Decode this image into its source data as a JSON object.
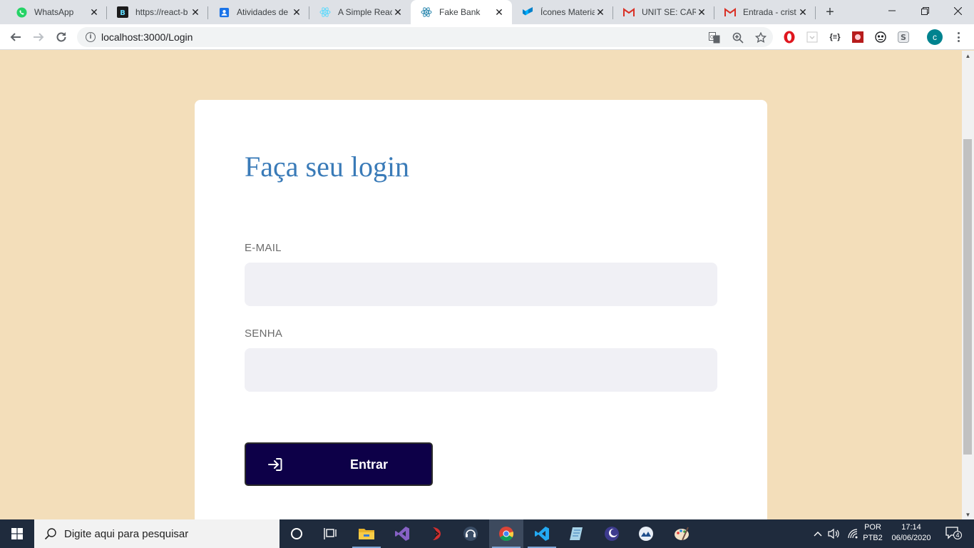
{
  "browser": {
    "tabs": [
      {
        "title": "WhatsApp",
        "icon": "whatsapp-icon"
      },
      {
        "title": "https://react-b",
        "icon": "react-bootstrap-icon"
      },
      {
        "title": "Atividades de ",
        "icon": "contacts-icon"
      },
      {
        "title": "A Simple React",
        "icon": "react-icon"
      },
      {
        "title": "Fake Bank",
        "icon": "react-icon",
        "active": true
      },
      {
        "title": "Ícones Materia",
        "icon": "material-icon"
      },
      {
        "title": "UNIT SE: CART",
        "icon": "gmail-icon"
      },
      {
        "title": "Entrada - crist",
        "icon": "gmail-icon"
      }
    ],
    "url": "localhost:3000/Login",
    "profile_initial": "c",
    "colors": {
      "profile": "#00838f",
      "tab_strip": "#dee1e6"
    }
  },
  "page": {
    "title": "Faça seu login",
    "email_label": "E-MAIL",
    "email_value": "",
    "password_label": "SENHA",
    "password_value": "",
    "submit_label": "Entrar",
    "colors": {
      "background": "#f3deba",
      "title": "#3a7bb8",
      "button": "#0d0048",
      "input": "#f0f0f5"
    }
  },
  "taskbar": {
    "search_placeholder": "Digite aqui para pesquisar",
    "language_top": "POR",
    "language_bottom": "PTB2",
    "time": "17:14",
    "date": "06/06/2020",
    "notification_count": "4"
  }
}
